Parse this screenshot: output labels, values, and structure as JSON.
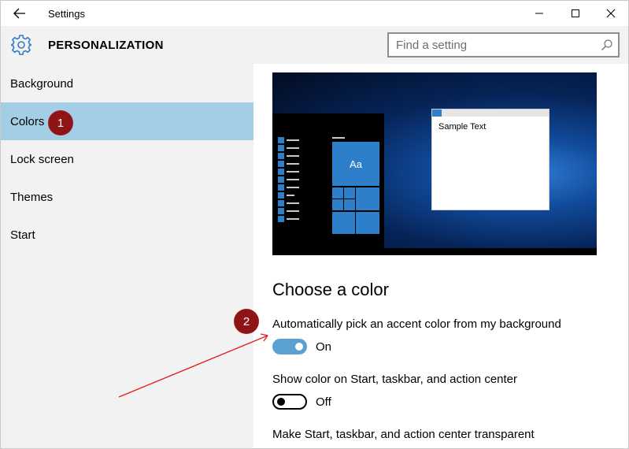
{
  "window": {
    "title": "Settings",
    "page_title": "PERSONALIZATION"
  },
  "search": {
    "placeholder": "Find a setting",
    "value": ""
  },
  "sidebar": {
    "items": [
      {
        "label": "Background",
        "selected": false
      },
      {
        "label": "Colors",
        "selected": true
      },
      {
        "label": "Lock screen",
        "selected": false
      },
      {
        "label": "Themes",
        "selected": false
      },
      {
        "label": "Start",
        "selected": false
      }
    ]
  },
  "preview": {
    "tile_label": "Aa",
    "sample_text": "Sample Text"
  },
  "content": {
    "section_title": "Choose a color",
    "settings": [
      {
        "label": "Automatically pick an accent color from my background",
        "state": "On",
        "on": true
      },
      {
        "label": "Show color on Start, taskbar, and action center",
        "state": "Off",
        "on": false
      },
      {
        "label": "Make Start, taskbar, and action center transparent"
      }
    ]
  },
  "annotations": {
    "badges": [
      "1",
      "2"
    ]
  },
  "colors": {
    "accent": "#2e7fc9",
    "selected_nav": "#a4cde6",
    "toggle_on": "#5aa1d3",
    "badge": "#8e1416",
    "arrow": "#e02020"
  },
  "icons": {
    "back": "back-arrow-icon",
    "settings": "gear-icon",
    "search": "search-icon",
    "minimize": "minimize-icon",
    "maximize": "maximize-icon",
    "close": "close-icon"
  }
}
